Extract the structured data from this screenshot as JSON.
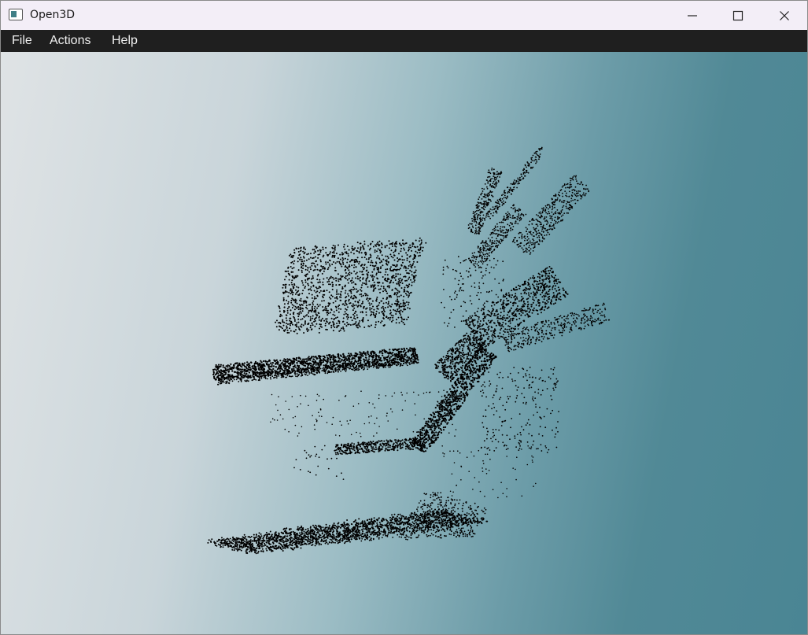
{
  "window": {
    "title": "Open3D",
    "icon": "open3d-app-icon",
    "controls": [
      "minimize-icon",
      "maximize-icon",
      "close-icon"
    ]
  },
  "menubar": {
    "items": [
      {
        "label": "File"
      },
      {
        "label": "Actions"
      },
      {
        "label": "Help"
      }
    ]
  },
  "viewport": {
    "content": "point-cloud",
    "point_color": "#000000",
    "background_colors": [
      "#dfe3e5",
      "#4a8594"
    ]
  }
}
